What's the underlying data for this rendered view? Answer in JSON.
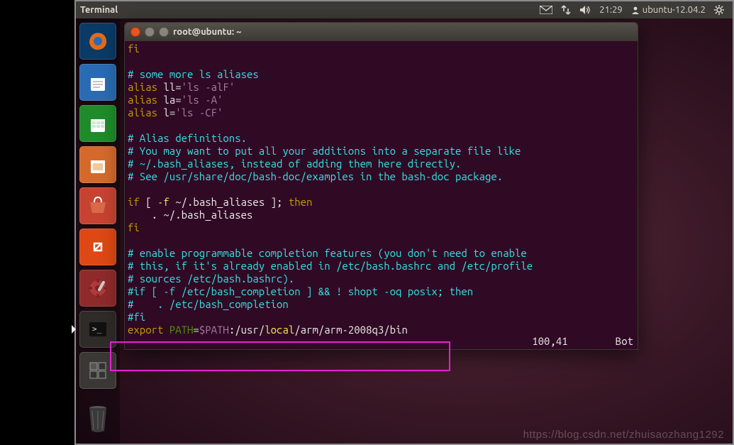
{
  "panel": {
    "title": "Terminal",
    "time": "21:29",
    "user": "ubuntu-12.04.2"
  },
  "launcher": {
    "items": [
      {
        "name": "firefox-icon",
        "bg": "#0a3a66"
      },
      {
        "name": "writer-icon",
        "bg": "#2a6bb3"
      },
      {
        "name": "calc-icon",
        "bg": "#1f8b2a"
      },
      {
        "name": "impress-icon",
        "bg": "#d36a2b"
      },
      {
        "name": "software-center-icon",
        "bg": "#c74331"
      },
      {
        "name": "ubuntu-one-icon",
        "bg": "#dd4814"
      },
      {
        "name": "settings-icon",
        "bg": "#8f2a2a"
      },
      {
        "name": "terminal-icon",
        "bg": "#2e2b28",
        "active": true
      },
      {
        "name": "workspace-switcher-icon",
        "bg": "#3a3734"
      }
    ],
    "trash": {
      "name": "trash-icon",
      "bg": "rgba(0,0,0,0)"
    }
  },
  "window": {
    "title": "root@ubuntu: ~"
  },
  "editor": {
    "lines": {
      "l0_a": "fi",
      "l1": "",
      "l2": "# some more ls aliases",
      "l3_a": "alias",
      "l3_b": " ll=",
      "l3_c": "'ls -alF'",
      "l4_a": "alias",
      "l4_b": " la=",
      "l4_c": "'ls -A'",
      "l5_a": "alias",
      "l5_b": " l=",
      "l5_c": "'ls -CF'",
      "l6": "",
      "l7": "# Alias definitions.",
      "l8": "# You may want to put all your additions into a separate file like",
      "l9": "# ~/.bash_aliases, instead of adding them here directly.",
      "l10": "# See /usr/share/doc/bash-doc/examples in the bash-doc package.",
      "l11": "",
      "l12_a": "if",
      "l12_b": " [ ",
      "l12_c": "-f",
      "l12_d": " ~/.bash_aliases ]; ",
      "l12_e": "then",
      "l13": "    . ~/.bash_aliases",
      "l14_a": "fi",
      "l15": "",
      "l16": "# enable programmable completion features (you don't need to enable",
      "l17": "# this, if it's already enabled in /etc/bash.bashrc and /etc/profile",
      "l18": "# sources /etc/bash.bashrc).",
      "l19": "#if [ -f /etc/bash_completion ] && ! shopt -oq posix; then",
      "l20": "#    . /etc/bash_completion",
      "l21": "#fi",
      "l22_a": "export",
      "l22_b": " PATH",
      "l22_c": "=",
      "l22_d": "$PATH",
      "l22_e": ":/usr/",
      "l22_f": "local",
      "l22_g": "/arm/arm-2008q3/bin"
    },
    "status_pos": "100,41",
    "status_where": "Bot"
  },
  "watermark": "https://blog.csdn.net/zhuisaozhang1292",
  "colors": {
    "term_bg": "#300a24",
    "highlight_border": "#e61ed6"
  }
}
